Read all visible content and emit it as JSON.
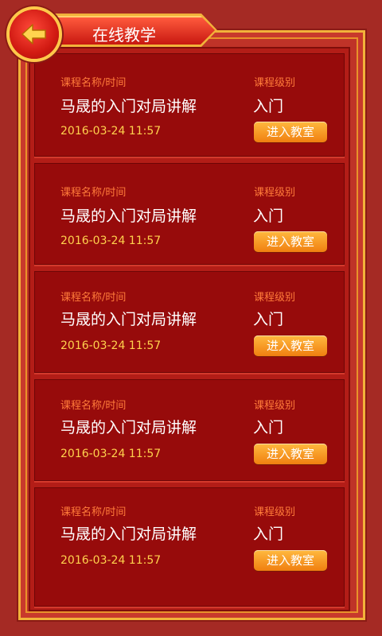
{
  "header": {
    "title": "在线教学",
    "back_icon": "arrow-left-icon"
  },
  "colors": {
    "background": "#a52a24",
    "card": "#970b0b",
    "gold": "#f2b23a",
    "button": "#f5971f",
    "label": "#ff7b3a",
    "time": "#ffd24d"
  },
  "courses": [
    {
      "name_label": "课程名称/时间",
      "level_label": "课程级别",
      "name": "马晟的入门对局讲解",
      "level": "入门",
      "time": "2016-03-24 11:57",
      "button": "进入教室"
    },
    {
      "name_label": "课程名称/时间",
      "level_label": "课程级别",
      "name": "马晟的入门对局讲解",
      "level": "入门",
      "time": "2016-03-24 11:57",
      "button": "进入教室"
    },
    {
      "name_label": "课程名称/时间",
      "level_label": "课程级别",
      "name": "马晟的入门对局讲解",
      "level": "入门",
      "time": "2016-03-24 11:57",
      "button": "进入教室"
    },
    {
      "name_label": "课程名称/时间",
      "level_label": "课程级别",
      "name": "马晟的入门对局讲解",
      "level": "入门",
      "time": "2016-03-24 11:57",
      "button": "进入教室"
    },
    {
      "name_label": "课程名称/时间",
      "level_label": "课程级别",
      "name": "马晟的入门对局讲解",
      "level": "入门",
      "time": "2016-03-24 11:57",
      "button": "进入教室"
    }
  ]
}
